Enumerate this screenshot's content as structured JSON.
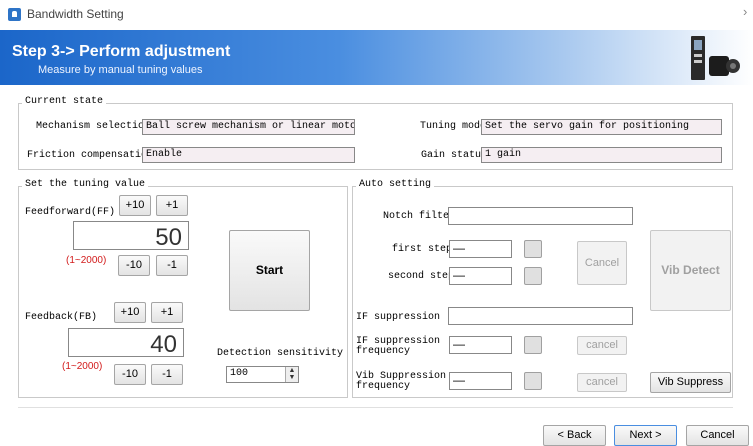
{
  "window": {
    "title": "Bandwidth Setting",
    "close_glyph": "›"
  },
  "banner": {
    "title": "Step 3-> Perform adjustment",
    "subtitle": "Measure by manual tuning values",
    "brand_color": "#1b66c9"
  },
  "current_state": {
    "label": "Current state",
    "mechanism_label": "Mechanism selection",
    "mechanism_value": "Ball screw mechanism or linear motor",
    "tuning_mode_label": "Tuning mode",
    "tuning_mode_value": "Set the servo gain for positioning",
    "friction_label": "Friction compensation",
    "friction_value": "Enable",
    "gain_status_label": "Gain status",
    "gain_status_value": "1 gain"
  },
  "tuning": {
    "label": "Set the tuning value",
    "ff_label": "Feedforward(FF)",
    "ff_value": "50",
    "ff_range": "(1~2000)",
    "fb_label": "Feedback(FB)",
    "fb_value": "40",
    "fb_range": "(1~2000)",
    "plus10": "+10",
    "plus1": "+1",
    "minus10": "-10",
    "minus1": "-1",
    "start": "Start",
    "sensitivity_label": "Detection sensitivity",
    "sensitivity_value": "100"
  },
  "auto": {
    "label": "Auto setting",
    "notch_label": "Notch filter",
    "first_step_label": "first step",
    "first_step_value": "—",
    "second_step_label": "second step",
    "second_step_value": "—",
    "cancel_label": "Cancel",
    "vib_detect_label": "Vib Detect",
    "if_suppression_label": "IF suppression",
    "if_freq_label_1": "IF suppression",
    "if_freq_label_2": "frequency",
    "if_freq_value": "—",
    "if_cancel_label": "cancel",
    "vib_supp_label_1": "Vib Suppression",
    "vib_supp_label_2": "frequency",
    "vib_supp_value": "—",
    "vib_cancel_label": "cancel",
    "vib_suppress_label": "Vib Suppress"
  },
  "footer": {
    "back_label": "< Back",
    "next_label": "Next >",
    "cancel_label": "Cancel"
  }
}
